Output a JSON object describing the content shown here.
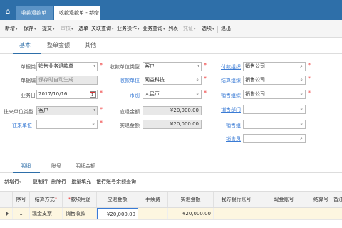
{
  "window_tabs": {
    "home": "⌂",
    "tab1": "收款退款单",
    "tab2": "收款退款单 - 新增",
    "close": "x"
  },
  "toolbar": {
    "items": [
      "新增",
      "保存",
      "提交",
      "审核",
      "选单",
      "关联查询",
      "业务操作",
      "业务查询",
      "列表",
      "凭证",
      "选项",
      "退出"
    ],
    "dropdown_arrow": "▾"
  },
  "main_tabs": [
    "基本",
    "整单金额",
    "其他"
  ],
  "form": {
    "doc_type": {
      "label": "单据类型",
      "value": "销售业务退款单"
    },
    "doc_no": {
      "label": "单据编号",
      "value": "保存时自动生成"
    },
    "biz_date": {
      "label": "业务日期",
      "value": "2017/10/16",
      "cal_day": "1"
    },
    "contact_type": {
      "label": "往来单位类型",
      "value": "客户"
    },
    "contact_unit": {
      "label": "往来单位",
      "value": ""
    },
    "payer_type": {
      "label": "收款单位类型",
      "value": "客户"
    },
    "payer_unit": {
      "label": "收款单位",
      "value": "网益科技"
    },
    "currency": {
      "label": "币别",
      "value": "人民币"
    },
    "amount_due": {
      "label": "应退金额",
      "value": "¥20,000.00"
    },
    "actual_refund": {
      "label": "实退金额",
      "value": "¥20,000.00"
    },
    "pay_org": {
      "label": "付款组织",
      "value": "销售公司"
    },
    "settle_org": {
      "label": "结算组织",
      "value": "销售公司"
    },
    "sales_org": {
      "label": "销售组织",
      "value": "销售公司"
    },
    "sales_dept": {
      "label": "销售部门",
      "value": ""
    },
    "sales_group": {
      "label": "销售组",
      "value": ""
    },
    "salesman": {
      "label": "销售员",
      "value": ""
    }
  },
  "detail_tabs": [
    "明细",
    "账号",
    "明细金额"
  ],
  "detail_toolbar": [
    "新增行",
    "复制行",
    "删除行",
    "批量填充",
    "银行账号余额查询"
  ],
  "grid": {
    "headers": [
      "序号",
      "结算方式",
      "款项用途",
      "应退金额",
      "手续费",
      "实退金额",
      "我方银行账号",
      "现金账号",
      "结算号",
      "备注"
    ],
    "required_mark": "*",
    "rows": [
      {
        "seq": "1",
        "settle": "现金支票",
        "purpose": "销售收款",
        "due": "¥20,000.00",
        "fee": "",
        "actual": "¥20,000.00",
        "bank": "",
        "cash": "",
        "settle_no": "",
        "note": ""
      }
    ]
  },
  "colors": {
    "accent": "#2e6fa9",
    "required": "#e33",
    "link": "#3a7bd5",
    "row_highlight": "#fdf6e0"
  }
}
